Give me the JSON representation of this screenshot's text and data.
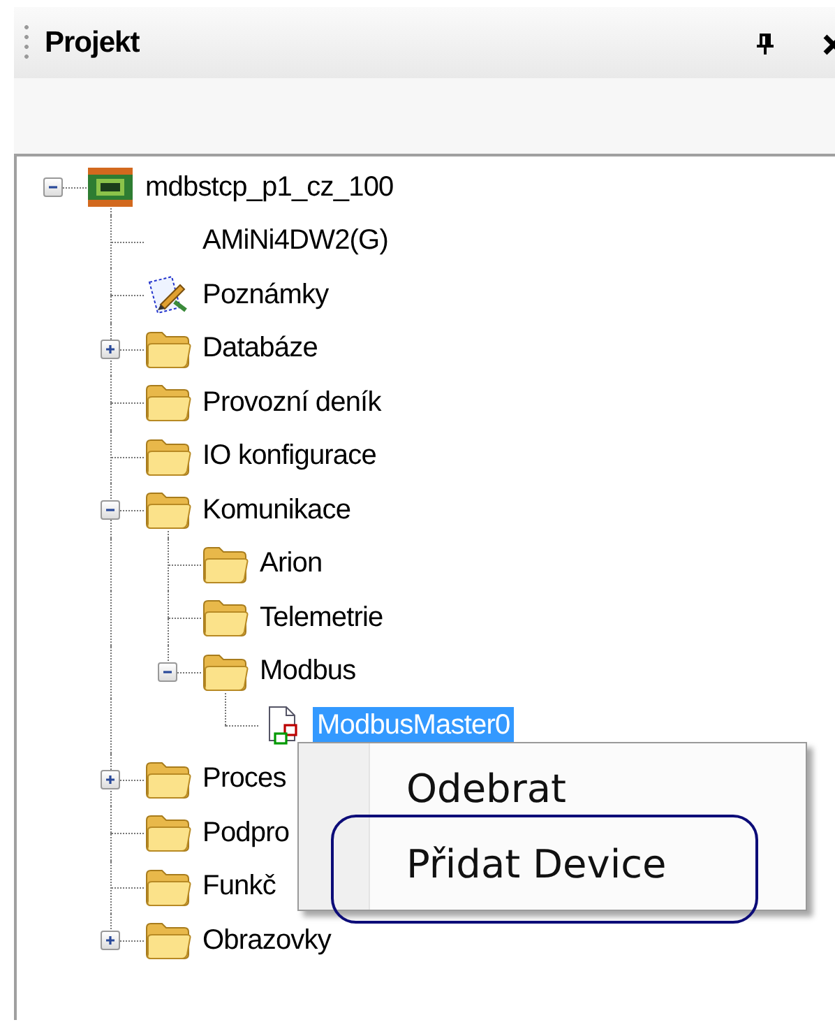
{
  "panel": {
    "title": "Projekt"
  },
  "tree": [
    {
      "label": "mdbstcp_p1_cz_100",
      "kind": "device",
      "expanded": true,
      "selected": false,
      "children": [
        {
          "label": "AMiNi4DW2(G)",
          "selected": false
        },
        {
          "label": "Poznámky",
          "kind": "notes",
          "selected": false
        },
        {
          "label": "Databáze",
          "kind": "folder",
          "expanded": false,
          "selected": false
        },
        {
          "label": "Provozní deník",
          "kind": "folder",
          "selected": false
        },
        {
          "label": "IO konfigurace",
          "kind": "folder",
          "selected": false
        },
        {
          "label": "Komunikace",
          "kind": "folder",
          "expanded": true,
          "selected": false,
          "children": [
            {
              "label": "Arion",
              "kind": "folder",
              "selected": false
            },
            {
              "label": "Telemetrie",
              "kind": "folder",
              "selected": false
            },
            {
              "label": "Modbus",
              "kind": "folder",
              "expanded": true,
              "selected": false,
              "children": [
                {
                  "label": "ModbusMaster0",
                  "kind": "master",
                  "selected": true
                }
              ]
            }
          ]
        },
        {
          "label": "Proces",
          "kind": "folder",
          "expanded": false,
          "selected": false
        },
        {
          "label": "Podpro",
          "kind": "folder",
          "selected": false
        },
        {
          "label": "Funkč",
          "kind": "folder",
          "selected": false
        },
        {
          "label": "Obrazovky",
          "kind": "folder",
          "expanded": false,
          "selected": false
        }
      ]
    }
  ],
  "context_menu": {
    "items": [
      {
        "label": "Odebrat",
        "outlined": false
      },
      {
        "label": "Přidat Device",
        "outlined": true
      }
    ]
  }
}
